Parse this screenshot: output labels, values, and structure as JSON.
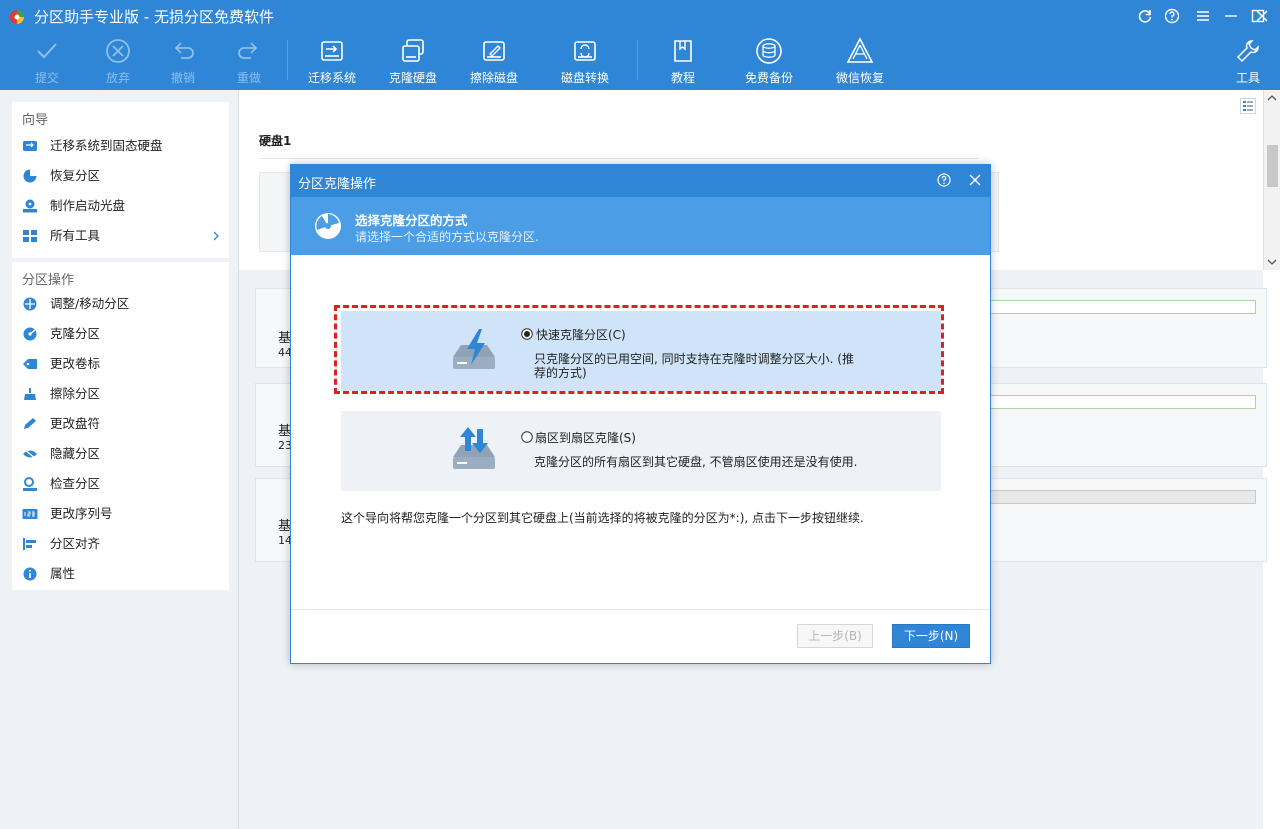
{
  "app": {
    "title": "分区助手专业版 - 无损分区免费软件"
  },
  "toolbar": {
    "items": [
      {
        "label": "提交",
        "icon": "check-icon",
        "enabled": false
      },
      {
        "label": "放弃",
        "icon": "discard-icon",
        "enabled": false
      },
      {
        "label": "撤销",
        "icon": "undo-icon",
        "enabled": false
      },
      {
        "label": "重做",
        "icon": "redo-icon",
        "enabled": false
      },
      {
        "label": "迁移系统",
        "icon": "migrate-os-icon",
        "enabled": true
      },
      {
        "label": "克隆硬盘",
        "icon": "clone-disk-icon",
        "enabled": true
      },
      {
        "label": "擦除磁盘",
        "icon": "wipe-disk-icon",
        "enabled": true
      },
      {
        "label": "磁盘转换",
        "icon": "disk-convert-icon",
        "enabled": true
      },
      {
        "label": "教程",
        "icon": "tutorial-icon",
        "enabled": true
      },
      {
        "label": "免费备份",
        "icon": "backup-icon",
        "enabled": true
      },
      {
        "label": "微信恢复",
        "icon": "wechat-recover-icon",
        "enabled": true
      },
      {
        "label": "工具",
        "icon": "tools-icon",
        "enabled": true
      }
    ]
  },
  "sidebar": {
    "wizard": {
      "title": "向导",
      "items": [
        {
          "label": "迁移系统到固态硬盘",
          "icon": "migrate-ssd-icon"
        },
        {
          "label": "恢复分区",
          "icon": "recover-partition-icon"
        },
        {
          "label": "制作启动光盘",
          "icon": "bootable-media-icon"
        },
        {
          "label": "所有工具",
          "icon": "all-tools-icon"
        }
      ]
    },
    "ops": {
      "title": "分区操作",
      "items": [
        {
          "label": "调整/移动分区",
          "icon": "resize-move-icon"
        },
        {
          "label": "克隆分区",
          "icon": "clone-partition-icon"
        },
        {
          "label": "更改卷标",
          "icon": "label-tag-icon"
        },
        {
          "label": "擦除分区",
          "icon": "wipe-partition-icon"
        },
        {
          "label": "更改盘符",
          "icon": "pencil-icon"
        },
        {
          "label": "隐藏分区",
          "icon": "hide-eye-icon"
        },
        {
          "label": "检查分区",
          "icon": "check-partition-icon"
        },
        {
          "label": "更改序列号",
          "icon": "serial-number-icon"
        },
        {
          "label": "分区对齐",
          "icon": "align-icon"
        },
        {
          "label": "属性",
          "icon": "info-icon"
        }
      ]
    }
  },
  "main": {
    "disk_header": "硬盘1",
    "disk_rows": [
      {
        "label": "基",
        "size": "44"
      },
      {
        "label": "基",
        "size": "23"
      },
      {
        "label": "基",
        "size": "14"
      }
    ]
  },
  "dialog": {
    "title": "分区克隆操作",
    "heading": "选择克隆分区的方式",
    "subheading": "请选择一个合适的方式以克隆分区.",
    "options": [
      {
        "label": "快速克隆分区(C)",
        "desc_line1": "只克隆分区的已用空间, 同时支持在克隆时调整分区大小. (推",
        "desc_line2": "荐的方式)",
        "selected": true,
        "icon": "fast-clone-icon"
      },
      {
        "label": "扇区到扇区克隆(S)",
        "desc_line1": "克隆分区的所有扇区到其它硬盘, 不管扇区使用还是没有使用.",
        "desc_line2": "",
        "selected": false,
        "icon": "sector-clone-icon"
      }
    ],
    "note": "这个导向将帮您克隆一个分区到其它硬盘上(当前选择的将被克隆的分区为*:), 点击下一步按钮继续.",
    "prev_button": "上一步(B)",
    "next_button": "下一步(N)"
  },
  "colors": {
    "accent": "#2f86d6",
    "highlight_border": "#e02020"
  }
}
